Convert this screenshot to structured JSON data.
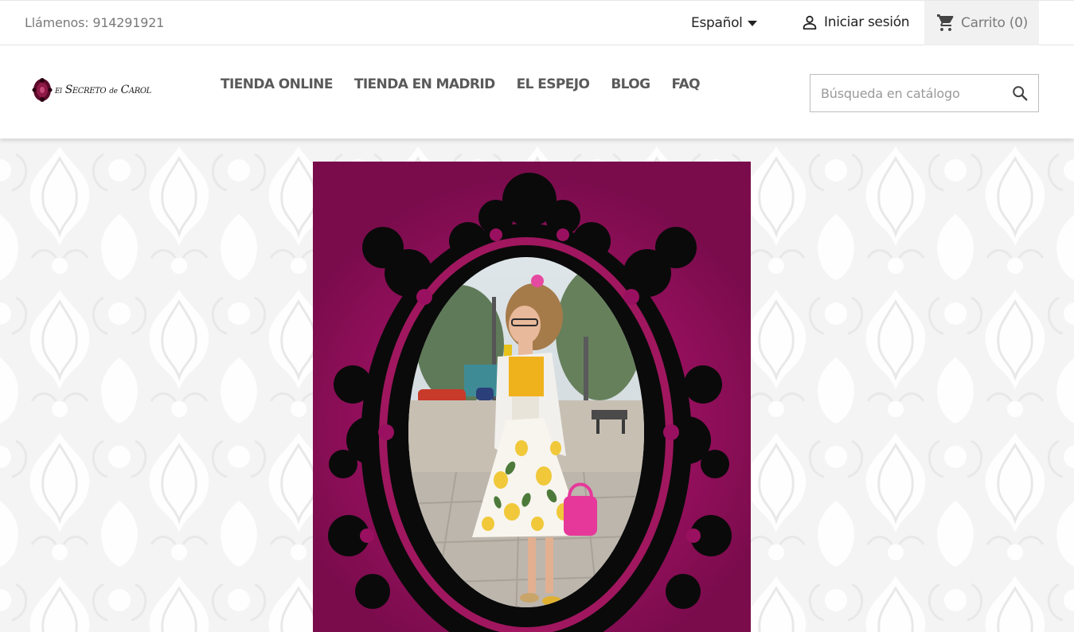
{
  "topbar": {
    "contact_text": "Llámenos: 914291921",
    "language_label": "Español",
    "login_label": "Iniciar sesión",
    "cart_label": "Carrito (0)"
  },
  "header": {
    "logo_small_1": "El",
    "logo_word_1": "Secreto",
    "logo_small_2": "de",
    "logo_word_2": "Carol",
    "nav": [
      {
        "label": "TIENDA ONLINE"
      },
      {
        "label": "TIENDA EN MADRID"
      },
      {
        "label": "EL ESPEJO"
      },
      {
        "label": "BLOG"
      },
      {
        "label": "FAQ"
      }
    ],
    "search_placeholder": "Búsqueda en catálogo"
  },
  "icons": {
    "user": "user-icon",
    "cart": "cart-icon",
    "search": "search-icon",
    "caret": "caret-down-icon"
  },
  "colors": {
    "banner": "#9a1060",
    "frame": "#0a0a0a",
    "nav_text": "#5a5a5a",
    "cart_bg": "#f1f1f1"
  }
}
